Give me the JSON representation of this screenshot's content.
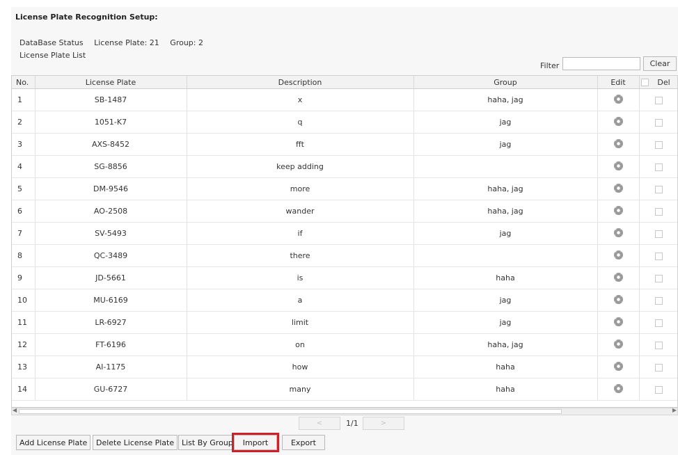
{
  "page": {
    "title": "License Plate Recognition Setup:",
    "database_status_label": "DataBase Status",
    "license_plate_count": "License Plate: 21",
    "group_count": "Group: 2",
    "list_label": "License Plate List"
  },
  "filter": {
    "label": "Filter",
    "value": "",
    "clear_label": "Clear"
  },
  "table": {
    "headers": {
      "no": "No.",
      "plate": "License Plate",
      "description": "Description",
      "group": "Group",
      "edit": "Edit",
      "del": "Del"
    },
    "rows": [
      {
        "no": "1",
        "plate": "SB-1487",
        "description": "x",
        "group": "haha, jag"
      },
      {
        "no": "2",
        "plate": "1051-K7",
        "description": "q",
        "group": "jag"
      },
      {
        "no": "3",
        "plate": "AXS-8452",
        "description": "fft",
        "group": "jag"
      },
      {
        "no": "4",
        "plate": "SG-8856",
        "description": "keep adding",
        "group": ""
      },
      {
        "no": "5",
        "plate": "DM-9546",
        "description": "more",
        "group": "haha, jag"
      },
      {
        "no": "6",
        "plate": "AO-2508",
        "description": "wander",
        "group": "haha, jag"
      },
      {
        "no": "7",
        "plate": "SV-5493",
        "description": "if",
        "group": "jag"
      },
      {
        "no": "8",
        "plate": "QC-3489",
        "description": "there",
        "group": ""
      },
      {
        "no": "9",
        "plate": "JD-5661",
        "description": "is",
        "group": "haha"
      },
      {
        "no": "10",
        "plate": "MU-6169",
        "description": "a",
        "group": "jag"
      },
      {
        "no": "11",
        "plate": "LR-6927",
        "description": "limit",
        "group": "jag"
      },
      {
        "no": "12",
        "plate": "FT-6196",
        "description": "on",
        "group": "haha, jag"
      },
      {
        "no": "13",
        "plate": "AI-1175",
        "description": "how",
        "group": "haha"
      },
      {
        "no": "14",
        "plate": "GU-6727",
        "description": "many",
        "group": "haha"
      }
    ]
  },
  "pager": {
    "prev": "<",
    "next": ">",
    "text": "1/1"
  },
  "actions": {
    "add": "Add License Plate",
    "delete": "Delete License Plate",
    "list_by_group": "List By Group",
    "import": "Import",
    "export": "Export"
  },
  "icons": {
    "edit": "gear-icon",
    "delete": "checkbox"
  },
  "colors": {
    "highlight": "#d11f2a"
  }
}
